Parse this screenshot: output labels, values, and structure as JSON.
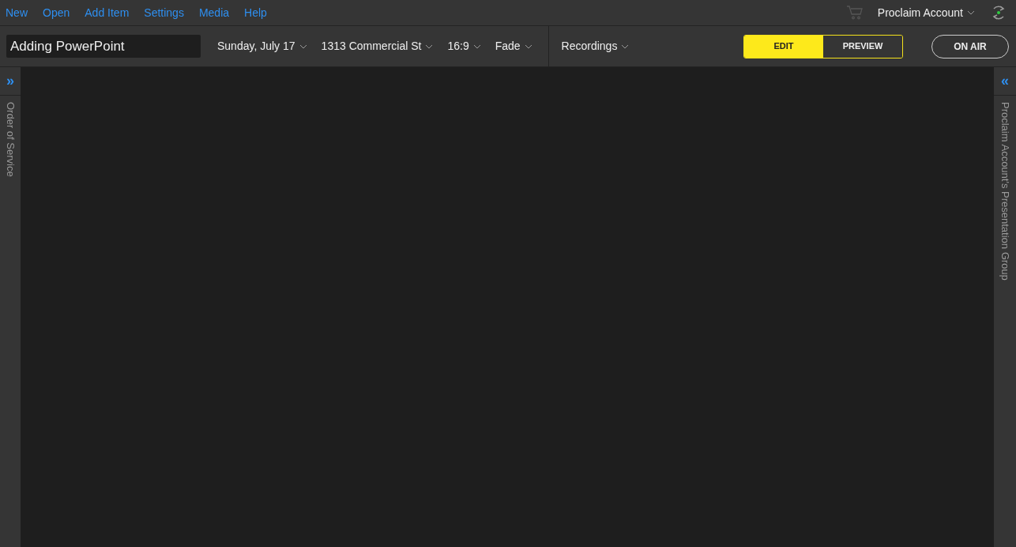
{
  "menu": [
    "New",
    "Open",
    "Add Item",
    "Settings",
    "Media",
    "Help"
  ],
  "account": {
    "name": "Proclaim Account",
    "sync_active": true
  },
  "toolbar": {
    "title": "Adding PowerPoint",
    "dropdowns": [
      "Sunday, July 17",
      "1313 Commercial St",
      "16:9",
      "Fade"
    ],
    "recordings": "Recordings",
    "modes": [
      {
        "label": "EDIT",
        "selected": true
      },
      {
        "label": "PREVIEW",
        "selected": false
      }
    ],
    "on_air": "ON AIR"
  },
  "left_panel": {
    "expand": "»",
    "title": "Order of Service"
  },
  "right_panel": {
    "expand": "«",
    "title": "Proclaim Account's Presentation Group"
  }
}
